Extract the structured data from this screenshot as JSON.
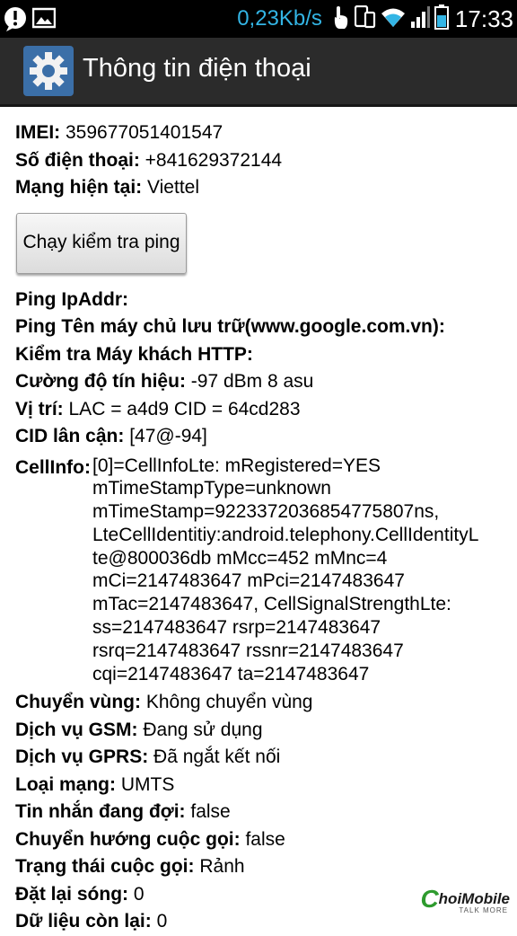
{
  "status_bar": {
    "left_icons": [
      "alert-icon",
      "image-icon"
    ],
    "speed": "0,23Kb/s",
    "right_icons": [
      "touch-icon",
      "devices-icon",
      "wifi-icon",
      "signal-icon",
      "battery-icon"
    ],
    "time": "17:33",
    "accent": "#33b5e5"
  },
  "action_bar": {
    "icon": "settings-gear-icon",
    "title": "Thông tin  điện thoại"
  },
  "info": {
    "imei": {
      "label": "IMEI:",
      "value": " 359677051401547"
    },
    "phone": {
      "label": "Số  điện thoại:",
      "value": " +841629372144"
    },
    "network": {
      "label": "Mạng hiện tại:",
      "value": " Viettel"
    }
  },
  "ping_button": "Chạy kiểm tra ping",
  "ping": {
    "ipaddr": {
      "label": "Ping IpAddr:",
      "value": ""
    },
    "hostname": {
      "label": "Ping Tên máy chủ lưu trữ(www.google.com.vn):",
      "value": ""
    },
    "http": {
      "label": "Kiểm tra Máy khách HTTP:",
      "value": ""
    }
  },
  "signal": {
    "label": "Cường  độ tín hiệu:",
    "value": " -97 dBm   8 asu"
  },
  "location": {
    "label": "Vị trí:",
    "value": " LAC = a4d9   CID = 64cd283"
  },
  "neighbor_cid": {
    "label": "CID lân cận:",
    "value": " [47@-94]"
  },
  "cellinfo": {
    "label": "CellInfo:",
    "lines": [
      "[0]=CellInfoLte: mRegistered=YES",
      "mTimeStampType=unknown",
      "mTimeStamp=9223372036854775807ns,",
      "LteCellIdentitiy:android.telephony.CellIdentityL",
      "te@800036db mMcc=452 mMnc=4",
      "mCi=2147483647 mPci=2147483647",
      "mTac=2147483647, CellSignalStrengthLte:",
      "ss=2147483647 rsrp=2147483647",
      "rsrq=2147483647 rssnr=2147483647",
      "cqi=2147483647 ta=2147483647"
    ]
  },
  "roaming": {
    "label": "Chuyển vùng:",
    "value": " Không chuyển vùng"
  },
  "gsm": {
    "label": "Dịch vụ GSM:",
    "value": " Đang sử dụng"
  },
  "gprs": {
    "label": "Dịch vụ GPRS:",
    "value": " Đã ngắt kết nối"
  },
  "net_type": {
    "label": "Loại mạng:",
    "value": " UMTS"
  },
  "msg_waiting": {
    "label": "Tin nhắn  đang  đợi:",
    "value": " false"
  },
  "call_forward": {
    "label": "Chuyển hướng cuộc gọi:",
    "value": " false"
  },
  "call_state": {
    "label": "Trạng thái cuộc gọi:",
    "value": " Rảnh"
  },
  "radio_resets": {
    "label": "Đặt lại sóng:",
    "value": " 0"
  },
  "data_remaining": {
    "label": "Dữ liệu còn lại:",
    "value": " 0"
  },
  "watermark": {
    "text": "hoiMobile",
    "sub": "TALK MORE"
  }
}
